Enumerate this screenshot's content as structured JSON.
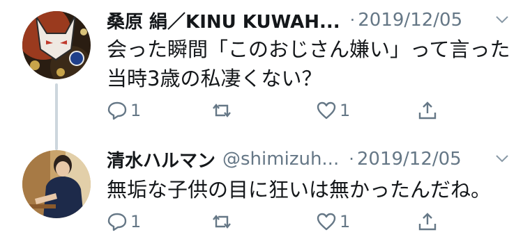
{
  "tweets": [
    {
      "name": "桑原 絹／KINU KUWAH...",
      "handle": "",
      "separator": "·",
      "date": "2019/12/05",
      "text": "会った瞬間「このおじさん嫌い」って言った\n当時3歳の私凄くない？",
      "reply_count": "1",
      "retweet_count": "",
      "like_count": "1",
      "avatar_icon": "fox-mask-avatar"
    },
    {
      "name": "清水ハルマン",
      "handle": "@shimizuh...",
      "separator": "·",
      "date": "2019/12/05",
      "text": "無垢な子供の目に狂いは無かったんだね。",
      "reply_count": "1",
      "retweet_count": "",
      "like_count": "1",
      "avatar_icon": "person-photo-avatar"
    }
  ],
  "colors": {
    "secondary": "#657786",
    "text": "#14171a",
    "thread_line": "#cdd6dd"
  },
  "icons": [
    "reply-icon",
    "retweet-icon",
    "like-icon",
    "share-icon",
    "chevron-down-icon"
  ]
}
